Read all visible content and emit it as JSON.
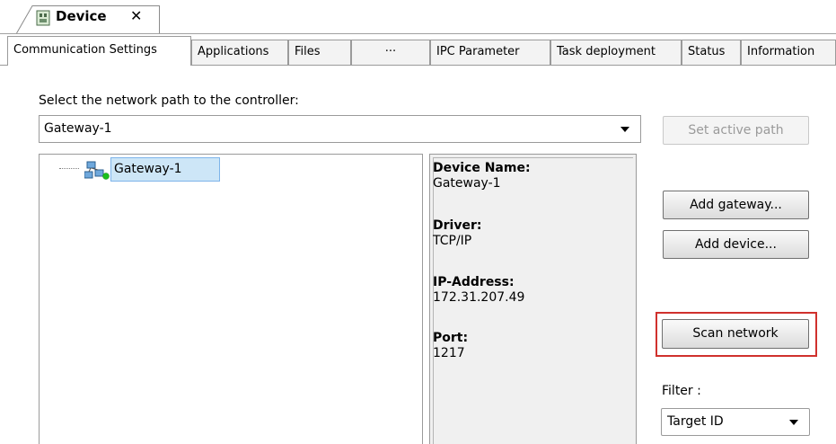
{
  "document_tab": {
    "title": "Device",
    "close_glyph": "✕",
    "icon": "device-icon"
  },
  "tabs": [
    {
      "label": "Communication Settings",
      "active": true
    },
    {
      "label": "Applications"
    },
    {
      "label": "Files"
    },
    {
      "label": "···"
    },
    {
      "label": "IPC Parameter"
    },
    {
      "label": "Task deployment"
    },
    {
      "label": "Status"
    },
    {
      "label": "Information"
    }
  ],
  "comm": {
    "select_label": "Select the network path to the controller:",
    "network_path_value": "Gateway-1",
    "set_active_path_label": "Set active path",
    "tree": {
      "node_label": "Gateway-1",
      "node_icon": "gateway-network-icon",
      "status_color": "#1bbf1b"
    },
    "info": {
      "device_name_label": "Device Name:",
      "device_name_value": "Gateway-1",
      "driver_label": "Driver:",
      "driver_value": "TCP/IP",
      "ip_label": "IP-Address:",
      "ip_value": "172.31.207.49",
      "port_label": "Port:",
      "port_value": "1217"
    },
    "add_gateway_label": "Add gateway...",
    "add_device_label": "Add device...",
    "scan_network_label": "Scan network",
    "filter_label": "Filter :",
    "filter_value": "Target ID"
  },
  "colors": {
    "highlight_border": "#d0312d",
    "selection_bg": "#cde6f7",
    "selection_border": "#7eb4ea"
  }
}
